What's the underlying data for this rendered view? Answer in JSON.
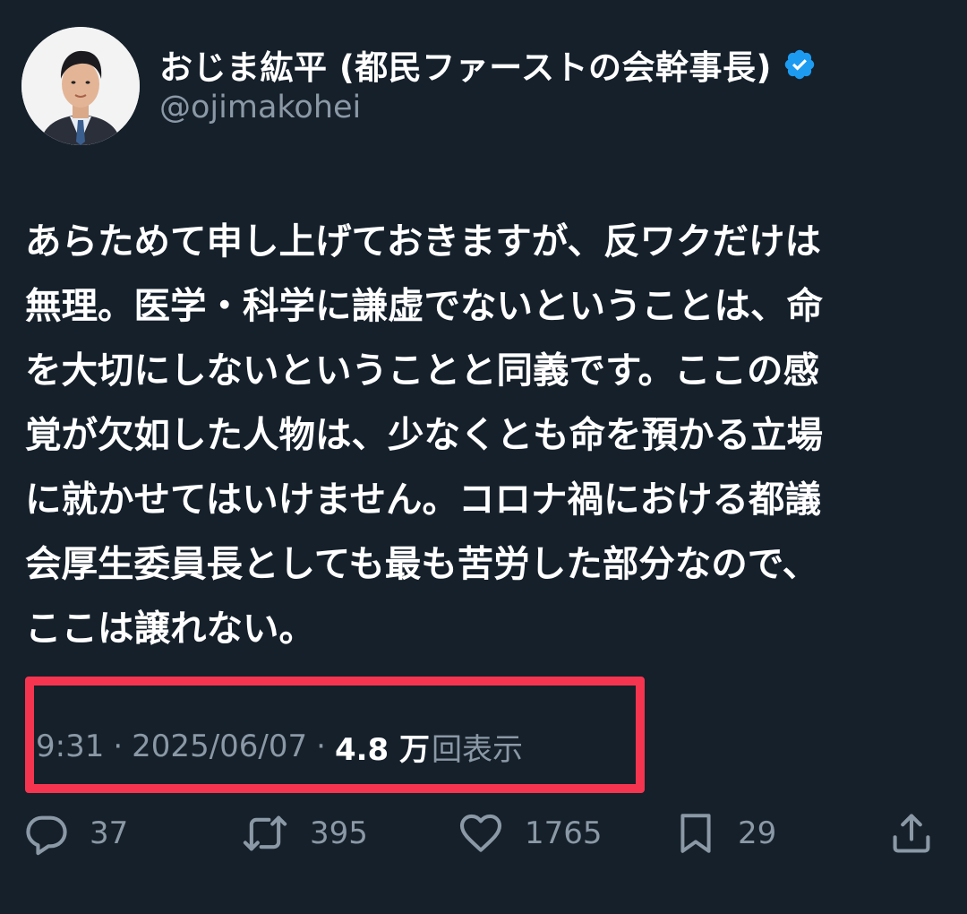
{
  "author": {
    "display_name": "おじま紘平 (都民ファーストの会幹事長)",
    "handle": "@ojimakohei",
    "verified_color": "#1d9bf0"
  },
  "tweet": {
    "lines": [
      "あらためて申し上げておきますが、反ワクだけは",
      "無理。医学・科学に謙虚でないということは、命",
      "を大切にしないということと同義です。ここの感",
      "覚が欠如した人物は、少なくとも命を預かる立場",
      "に就かせてはいけません。コロナ禍における都議",
      "会厚生委員長としても最も苦労した部分なので、",
      "ここは譲れない。"
    ]
  },
  "meta": {
    "time": "9:31",
    "separator": "·",
    "date": "2025/06/07",
    "views_number": "4.8 万",
    "views_label": "回表示"
  },
  "actions": {
    "reply": {
      "icon": "reply-icon",
      "count": "37"
    },
    "retweet": {
      "icon": "retweet-icon",
      "count": "395"
    },
    "like": {
      "icon": "heart-icon",
      "count": "1765"
    },
    "bookmark": {
      "icon": "bookmark-icon",
      "count": "29"
    },
    "share": {
      "icon": "share-icon"
    }
  },
  "colors": {
    "background": "#15202b",
    "text_primary": "#ffffff",
    "text_secondary": "#8b98a5",
    "highlight_border": "#f5354f"
  }
}
